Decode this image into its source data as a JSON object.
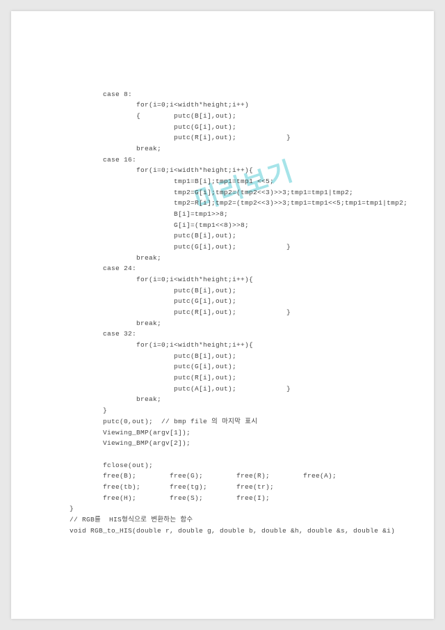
{
  "watermark": "미리보기",
  "code": {
    "l01": "        case 8:",
    "l02": "                for(i=0;i<width*height;i++)",
    "l03": "                {        putc(B[i],out);",
    "l04": "                         putc(G[i],out);",
    "l05": "                         putc(R[i],out);            }",
    "l06": "                break;",
    "l07": "        case 16:",
    "l08": "                for(i=0;i<width*height;i++){",
    "l09": "                         tmp1=B[i];tmp1=tmp1 <<5;",
    "l10": "                         tmp2=G[i];tmp2=(tmp2<<3)>>3;tmp1=tmp1|tmp2;",
    "l11": "                         tmp2=R[i];tmp2=(tmp2<<3)>>3;tmp1=tmp1<<5;tmp1=tmp1|tmp2;",
    "l12": "                         B[i]=tmp1>>8;",
    "l13": "                         G[i]=(tmp1<<8)>>8;",
    "l14": "                         putc(B[i],out);",
    "l15": "                         putc(G[i],out);            }",
    "l16": "                break;",
    "l17": "        case 24:",
    "l18": "                for(i=0;i<width*height;i++){",
    "l19": "                         putc(B[i],out);",
    "l20": "                         putc(G[i],out);",
    "l21": "                         putc(R[i],out);            }",
    "l22": "                break;",
    "l23": "        case 32:",
    "l24": "                for(i=0;i<width*height;i++){",
    "l25": "                         putc(B[i],out);",
    "l26": "                         putc(G[i],out);",
    "l27": "                         putc(R[i],out);",
    "l28": "                         putc(A[i],out);            }",
    "l29": "                break;",
    "l30": "        }",
    "l31": "        putc(0,out);  // bmp file 의 마지막 표시",
    "l32": "        Viewing_BMP(argv[1]);",
    "l33": "        Viewing_BMP(argv[2]);",
    "l34": "",
    "l35": "        fclose(out);",
    "l36": "        free(B);        free(G);        free(R);        free(A);",
    "l37": "        free(tb);       free(tg);       free(tr);",
    "l38": "        free(H);        free(S);        free(I);",
    "l39": "}",
    "l40": "// RGB를  HIS형식으로 변환하는 함수",
    "l41": "void RGB_to_HIS(double r, double g, double b, double &h, double &s, double &i)"
  }
}
